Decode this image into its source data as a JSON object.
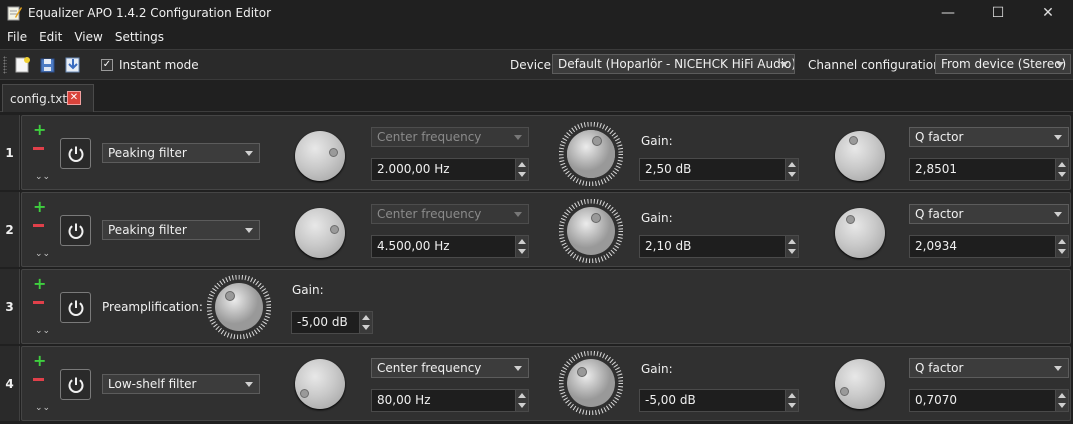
{
  "window": {
    "title": "Equalizer APO 1.4.2 Configuration Editor",
    "minimize": "—",
    "maximize": "☐",
    "close": "✕"
  },
  "menu": [
    "File",
    "Edit",
    "View",
    "Settings"
  ],
  "toolbar": {
    "instant_mode_label": "Instant mode",
    "instant_mode_checked": "✓",
    "device_label": "Device:",
    "device_value": "Default (Hoparlör - NICEHCK HiFi Audio)",
    "channel_label": "Channel configuration:",
    "channel_value": "From device (Stereo)"
  },
  "tab": {
    "label": "config.txt",
    "close": "✕"
  },
  "rows": [
    {
      "num": "1",
      "filter_type": "Peaking filter",
      "freq_mode": "Center frequency",
      "freq_value": "2.000,00 Hz",
      "gain_label": "Gain:",
      "gain_value": "2,50 dB",
      "q_mode": "Q factor",
      "q_value": "2,8501"
    },
    {
      "num": "2",
      "filter_type": "Peaking filter",
      "freq_mode": "Center frequency",
      "freq_value": "4.500,00 Hz",
      "gain_label": "Gain:",
      "gain_value": "2,10 dB",
      "q_mode": "Q factor",
      "q_value": "2,0934"
    },
    {
      "num": "3",
      "preamp_label": "Preamplification:",
      "gain_label": "Gain:",
      "gain_value": "-5,00 dB"
    },
    {
      "num": "4",
      "filter_type": "Low-shelf filter",
      "freq_mode": "Center frequency",
      "freq_value": "80,00 Hz",
      "gain_label": "Gain:",
      "gain_value": "-5,00 dB",
      "q_mode": "Q factor",
      "q_value": "0,7070"
    }
  ],
  "icons": {
    "add": "plus-icon",
    "remove": "minus-icon",
    "expand": "chevron-down-icon",
    "power": "power-icon"
  },
  "colors": {
    "add": "#3fcf3f",
    "remove": "#e0404a",
    "tab_close": "#d9433b"
  }
}
